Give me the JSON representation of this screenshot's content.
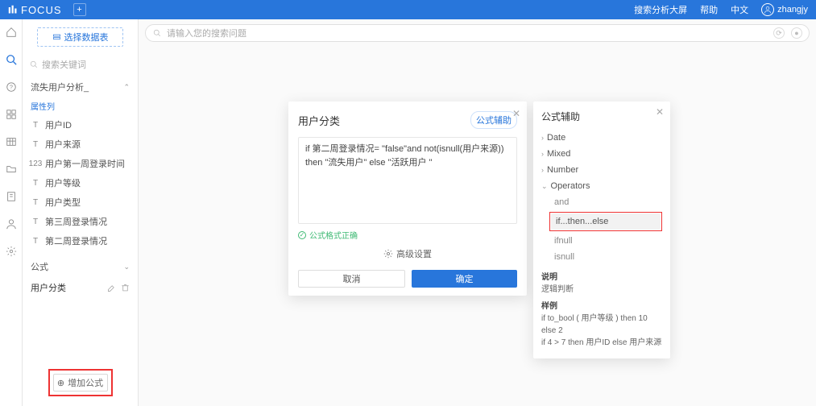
{
  "topbar": {
    "brand": "FOCUS",
    "right": {
      "analysis": "搜索分析大屏",
      "help": "帮助",
      "lang": "中文",
      "user": "zhangjy"
    }
  },
  "left": {
    "select_ds": "选择数据表",
    "search_placeholder": "搜索关键词",
    "section_title": "流失用户分析_",
    "attr_label": "属性列",
    "fields": {
      "f1": "用户ID",
      "f2": "用户来源",
      "f3": "用户第一周登录时间",
      "f4": "用户等级",
      "f5": "用户类型",
      "f6": "第三周登录情况",
      "f7": "第二周登录情况"
    },
    "formula_header": "公式",
    "formula_item": "用户分类",
    "add_formula": "增加公式"
  },
  "search": {
    "placeholder": "请输入您的搜索问题"
  },
  "modal": {
    "title": "用户分类",
    "helper_link": "公式辅助",
    "formula_text": "if 第二周登录情况= \"false\"and not(isnull(用户来源)) then \"流失用户\" else \"活跃用户 \"",
    "status": "公式格式正确",
    "advanced": "高级设置",
    "cancel": "取消",
    "confirm": "确定"
  },
  "helper": {
    "title": "公式辅助",
    "cats": {
      "date": "Date",
      "mixed": "Mixed",
      "number": "Number",
      "operators": "Operators"
    },
    "subs": {
      "and": "and",
      "ite": "if...then...else",
      "ifnull": "ifnull",
      "isnull": "isnull"
    },
    "desc_label": "说明",
    "desc_text": "逻辑判断",
    "example_label": "样例",
    "example_1": "if to_bool ( 用户等级 ) then 10 else 2",
    "example_2": "if 4 > 7 then 用户ID else 用户来源"
  }
}
